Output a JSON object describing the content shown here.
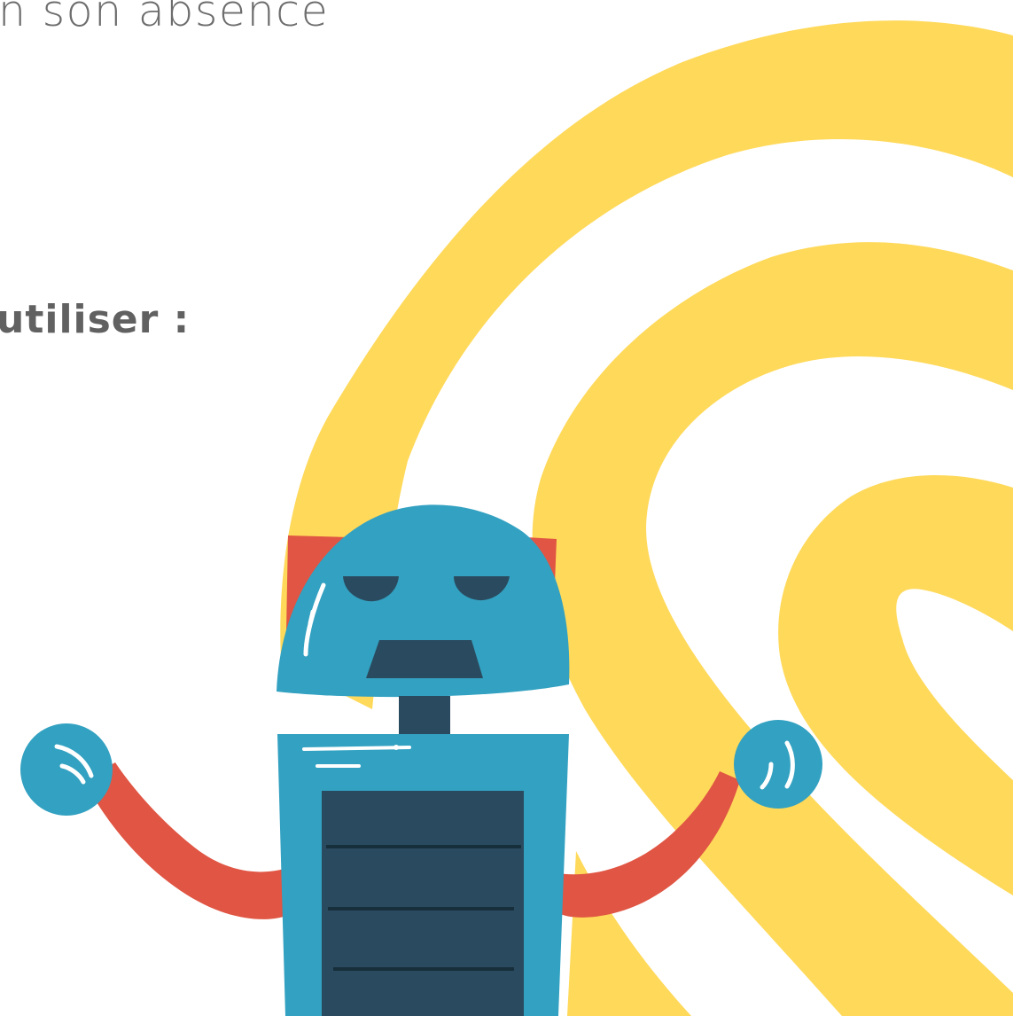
{
  "slide": {
    "line_1": "n son absence",
    "line_2": "utiliser :"
  },
  "colors": {
    "text": "#666666",
    "swirl": "#FFD95A",
    "robot_blue": "#33A1C1",
    "robot_dark": "#2A4B5F",
    "robot_red": "#E05543"
  },
  "illustration": {
    "subject": "robot",
    "background_shape": "yellow-fingerprint-swirl"
  }
}
